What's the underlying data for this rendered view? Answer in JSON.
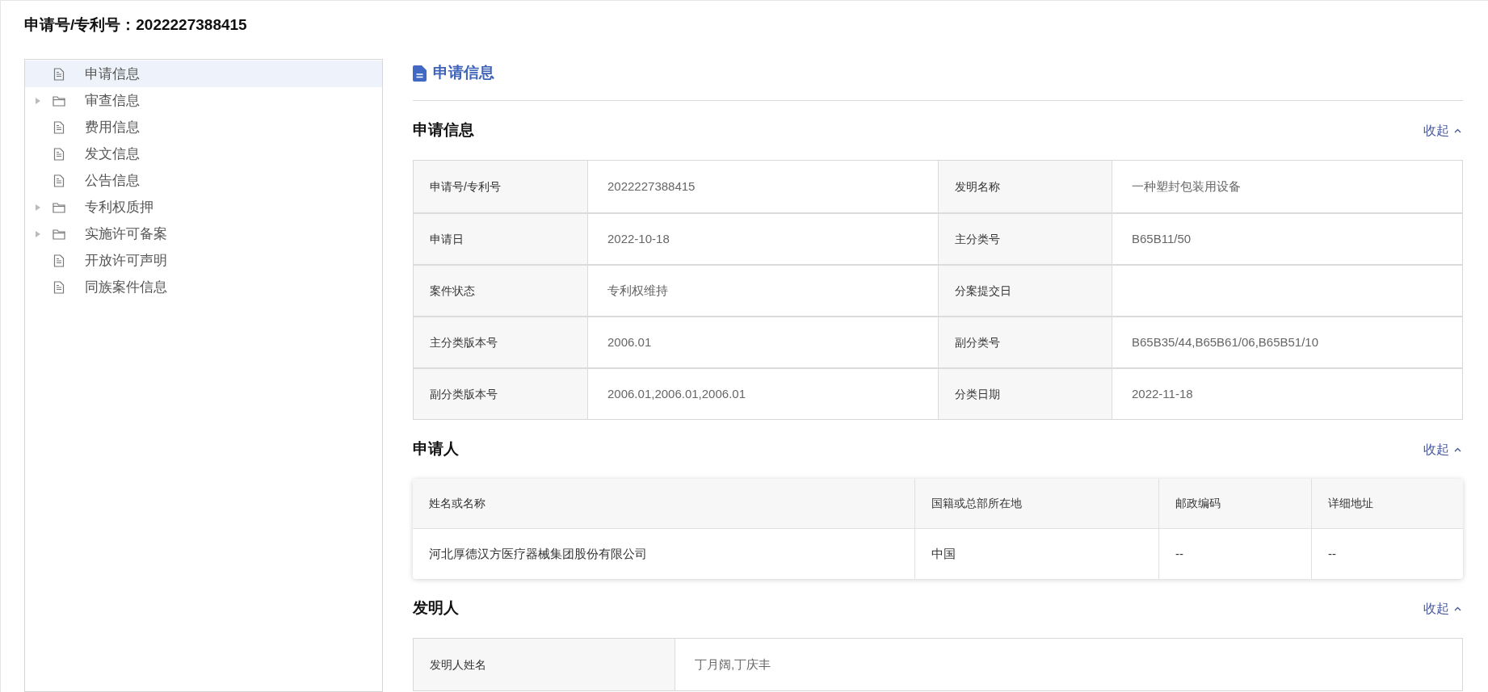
{
  "page_title": "申请号/专利号：2022227388415",
  "sidebar": {
    "items": [
      {
        "label": "申请信息",
        "kind": "file",
        "selected": true
      },
      {
        "label": "审查信息",
        "kind": "folder",
        "expanded": false,
        "selected": false
      },
      {
        "label": "费用信息",
        "kind": "file",
        "selected": false
      },
      {
        "label": "发文信息",
        "kind": "file",
        "selected": false
      },
      {
        "label": "公告信息",
        "kind": "file",
        "selected": false
      },
      {
        "label": "专利权质押",
        "kind": "folder",
        "expanded": false,
        "selected": false
      },
      {
        "label": "实施许可备案",
        "kind": "folder",
        "expanded": false,
        "selected": false
      },
      {
        "label": "开放许可声明",
        "kind": "file",
        "selected": false
      },
      {
        "label": "同族案件信息",
        "kind": "file",
        "selected": false
      }
    ]
  },
  "content_title": "申请信息",
  "sections": [
    {
      "title": "申请信息",
      "toggle": "收起",
      "expanded": true,
      "kind": "fields",
      "rows": [
        [
          {
            "label": "申请号/专利号",
            "value": "2022227388415"
          },
          {
            "label": "发明名称",
            "value": "一种塑封包装用设备"
          }
        ],
        [
          {
            "label": "申请日",
            "value": "2022-10-18"
          },
          {
            "label": "主分类号",
            "value": "B65B11/50"
          }
        ],
        [
          {
            "label": "案件状态",
            "value": "专利权维持"
          },
          {
            "label": "分案提交日"
          }
        ],
        [
          {
            "label": "主分类版本号",
            "value": "2006.01"
          },
          {
            "label": "副分类号",
            "value": "B65B35/44,B65B61/06,B65B51/10"
          }
        ],
        [
          {
            "label": "副分类版本号",
            "value": "2006.01,2006.01,2006.01"
          },
          {
            "label": "分类日期",
            "value": "2022-11-18"
          }
        ]
      ]
    },
    {
      "title": "申请人",
      "toggle": "收起",
      "expanded": true,
      "kind": "table",
      "columns": [
        "姓名或名称",
        "国籍或总部所在地",
        "邮政编码",
        "详细地址"
      ],
      "rows": [
        [
          "河北厚德汉方医疗器械集团股份有限公司",
          "中国",
          "--",
          "--"
        ]
      ]
    },
    {
      "title": "发明人",
      "toggle": "收起",
      "expanded": true,
      "kind": "fields",
      "rows": [
        [
          {
            "label": "发明人姓名",
            "value": "丁月阔,丁庆丰"
          }
        ]
      ]
    }
  ]
}
